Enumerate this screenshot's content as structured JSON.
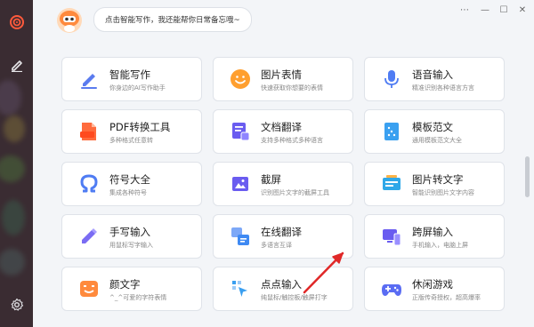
{
  "assistant": {
    "prompt": "点击智能写作，我还能帮你日常备忘哦~"
  },
  "window_controls": [
    "⋯",
    "—",
    "☐",
    "✕"
  ],
  "sidebar": {
    "items": [
      {
        "icon": "target-icon"
      },
      {
        "icon": "pen-icon"
      },
      {
        "icon": "settings-gear-icon"
      }
    ]
  },
  "features": [
    {
      "title": "智能写作",
      "desc": "你身边的AI写作助手",
      "icon": "ai-writing-icon",
      "color": "#5a7bef"
    },
    {
      "title": "图片表情",
      "desc": "快速获取你想要的表情",
      "icon": "smiley-icon",
      "color": "#ff9f2f"
    },
    {
      "title": "语音输入",
      "desc": "精准识别各种语言方言",
      "icon": "microphone-icon",
      "color": "#4f7cf3"
    },
    {
      "title": "PDF转换工具",
      "desc": "多种格式任意转",
      "icon": "pdf-icon",
      "color": "#ff6b3d"
    },
    {
      "title": "文档翻译",
      "desc": "支持多种格式多种语言",
      "icon": "document-translate-icon",
      "color": "#6a5cf0"
    },
    {
      "title": "模板范文",
      "desc": "通用模板范文大全",
      "icon": "template-icon",
      "color": "#3aa0f0"
    },
    {
      "title": "符号大全",
      "desc": "集成各种符号",
      "icon": "omega-symbol-icon",
      "color": "#4f7cf3"
    },
    {
      "title": "截屏",
      "desc": "识别图片文字的截屏工具",
      "icon": "screenshot-icon",
      "color": "#6a5cf0"
    },
    {
      "title": "图片转文字",
      "desc": "智能识别图片文字内容",
      "icon": "image-to-text-icon",
      "color": "#2fa8e8"
    },
    {
      "title": "手写输入",
      "desc": "用鼠标写字输入",
      "icon": "handwriting-icon",
      "color": "#7a6cf3"
    },
    {
      "title": "在线翻译",
      "desc": "多语言互译",
      "icon": "online-translate-icon",
      "color": "#3f8af3"
    },
    {
      "title": "跨屏输入",
      "desc": "手机输入，电脑上屏",
      "icon": "cross-screen-icon",
      "color": "#6a5cf0"
    },
    {
      "title": "颜文字",
      "desc": "^_^可爱的字符表情",
      "icon": "kaomoji-icon",
      "color": "#ff8a3d"
    },
    {
      "title": "点点输入",
      "desc": "纯鼠标/触控板/触屏打字",
      "icon": "dot-input-icon",
      "color": "#3a9ff0"
    },
    {
      "title": "休闲游戏",
      "desc": "正版传奇授权，超高爆率",
      "icon": "gamepad-icon",
      "color": "#5a6cf3"
    }
  ]
}
